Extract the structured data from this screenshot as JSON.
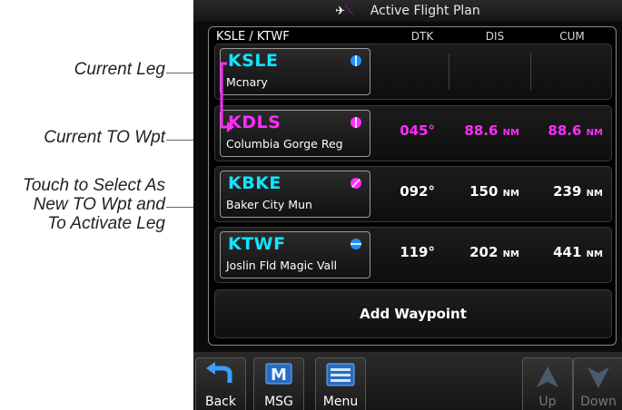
{
  "callouts": {
    "current_leg": "Current Leg",
    "current_to": "Current TO Wpt",
    "touch_line1": "Touch to Select As",
    "touch_line2": "New TO Wpt and",
    "touch_line3": "To Activate Leg"
  },
  "window": {
    "title": "Active Flight Plan",
    "plane_icon": "airplane-icon"
  },
  "plan": {
    "route": "KSLE / KTWF",
    "columns": {
      "dtk": "DTK",
      "dis": "DIS",
      "cum": "CUM"
    },
    "rows": [
      {
        "ident": "KSLE",
        "name": "Mcnary",
        "dtk": "",
        "dis": "",
        "dis_unit": "",
        "cum": "",
        "cum_unit": "",
        "ident_color": "#11e5ff",
        "icon": "airport-icon"
      },
      {
        "ident": "KDLS",
        "name": "Columbia Gorge Reg",
        "dtk": "045°",
        "dis": "88.6",
        "dis_unit": "NM",
        "cum": "88.6",
        "cum_unit": "NM",
        "ident_color": "#ff2cff",
        "icon": "airport-icon"
      },
      {
        "ident": "KBKE",
        "name": "Baker City Mun",
        "dtk": "092°",
        "dis": "150",
        "dis_unit": "NM",
        "cum": "239",
        "cum_unit": "NM",
        "ident_color": "#11e5ff",
        "icon": "airport-icon"
      },
      {
        "ident": "KTWF",
        "name": "Joslin Fld Magic Vall",
        "dtk": "119°",
        "dis": "202",
        "dis_unit": "NM",
        "cum": "441",
        "cum_unit": "NM",
        "ident_color": "#11e5ff",
        "icon": "airport-icon"
      }
    ],
    "add_waypoint": "Add Waypoint"
  },
  "toolbar": {
    "back": "Back",
    "msg": "MSG",
    "menu": "Menu",
    "up": "Up",
    "down": "Down"
  },
  "colors": {
    "active_leg": "#ff2cff",
    "ident_cyan": "#11e5ff"
  }
}
